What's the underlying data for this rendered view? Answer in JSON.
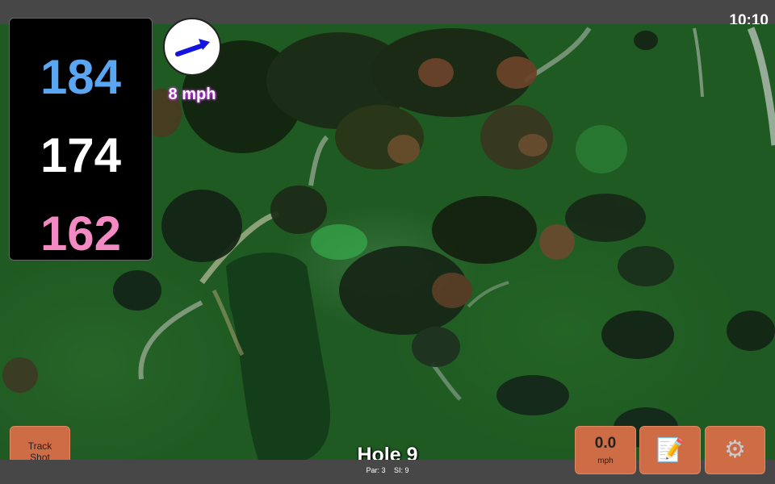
{
  "status_bar": {
    "time": "10:10"
  },
  "yardages": {
    "back": "184",
    "center": "174",
    "front": "162"
  },
  "wind": {
    "speed": "8 mph",
    "arrow_color": "#1414e0"
  },
  "buttons": {
    "track_shot_line1": "Track",
    "track_shot_line2": "Shot",
    "speed_value": "0.0",
    "speed_unit": "mph",
    "notes_icon": "notepad-icon",
    "settings_icon": "gear-icon"
  },
  "hole": {
    "title": "Hole 9",
    "par": "Par: 3",
    "si": "SI: 9"
  },
  "colors": {
    "button_bg": "#cd6c45",
    "back_yardage": "#5aa6f2",
    "center_yardage": "#ffffff",
    "front_yardage": "#f48ac4",
    "fairway": "#1f5a22"
  }
}
